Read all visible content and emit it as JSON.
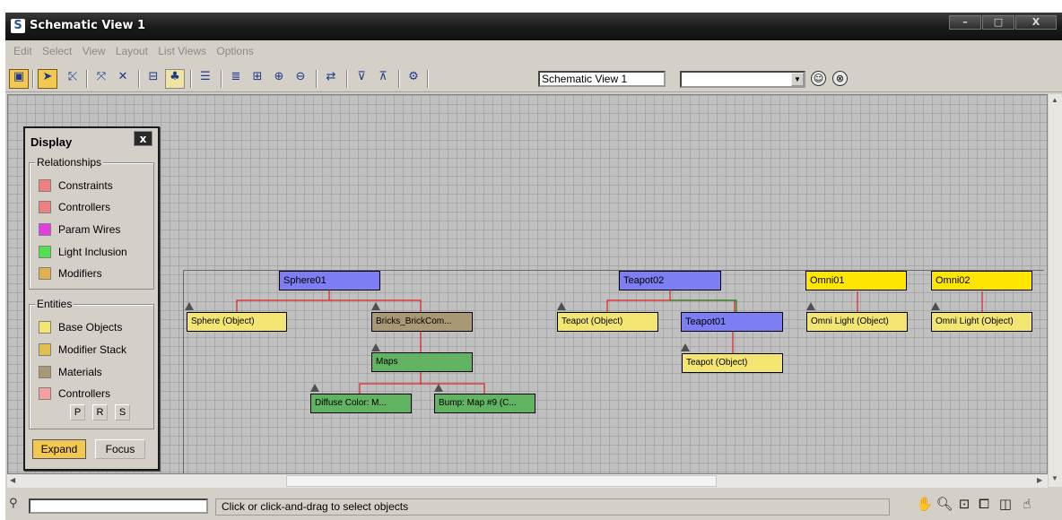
{
  "window": {
    "title": "Schematic View 1",
    "controls": [
      "–",
      "□",
      "X"
    ]
  },
  "menu": [
    "Edit",
    "Select",
    "View",
    "Layout",
    "List Views",
    "Options"
  ],
  "toolbar": {
    "view_name": "Schematic View 1",
    "filter_value": ""
  },
  "display_panel": {
    "title": "Display",
    "close": "x",
    "relationships_label": "Relationships",
    "relationships": [
      {
        "label": "Constraints",
        "color": "#f08080"
      },
      {
        "label": "Controllers",
        "color": "#f08080"
      },
      {
        "label": "Param Wires",
        "color": "#e040e0"
      },
      {
        "label": "Light Inclusion",
        "color": "#50e050"
      },
      {
        "label": "Modifiers",
        "color": "#e0b050"
      }
    ],
    "entities_label": "Entities",
    "entities": [
      {
        "label": "Base Objects",
        "color": "#f2e572"
      },
      {
        "label": "Modifier Stack",
        "color": "#e0c050"
      },
      {
        "label": "Materials",
        "color": "#a89873"
      },
      {
        "label": "Controllers",
        "color": "#f4a0a0"
      }
    ],
    "psr": [
      "P",
      "R",
      "S"
    ],
    "expand": "Expand",
    "focus": "Focus"
  },
  "nodes": {
    "sphere01": "Sphere01",
    "sphere_object": "Sphere (Object)",
    "bricks": "Bricks_BrickCom...",
    "maps": "Maps",
    "diffuse": "Diffuse Color: M...",
    "bump": "Bump: Map #9 (C...",
    "teapot02": "Teapot02",
    "teapot_object_1": "Teapot (Object)",
    "teapot01": "Teapot01",
    "teapot_object_2": "Teapot (Object)",
    "omni01": "Omni01",
    "omni_light_1": "Omni Light (Object)",
    "omni02": "Omni02",
    "omni_light_2": "Omni Light (Object)"
  },
  "colors": {
    "hierarchy_wire": "#e02020",
    "light_wire": "#208020"
  },
  "status": {
    "message": "Click or click-and-drag to select objects"
  }
}
